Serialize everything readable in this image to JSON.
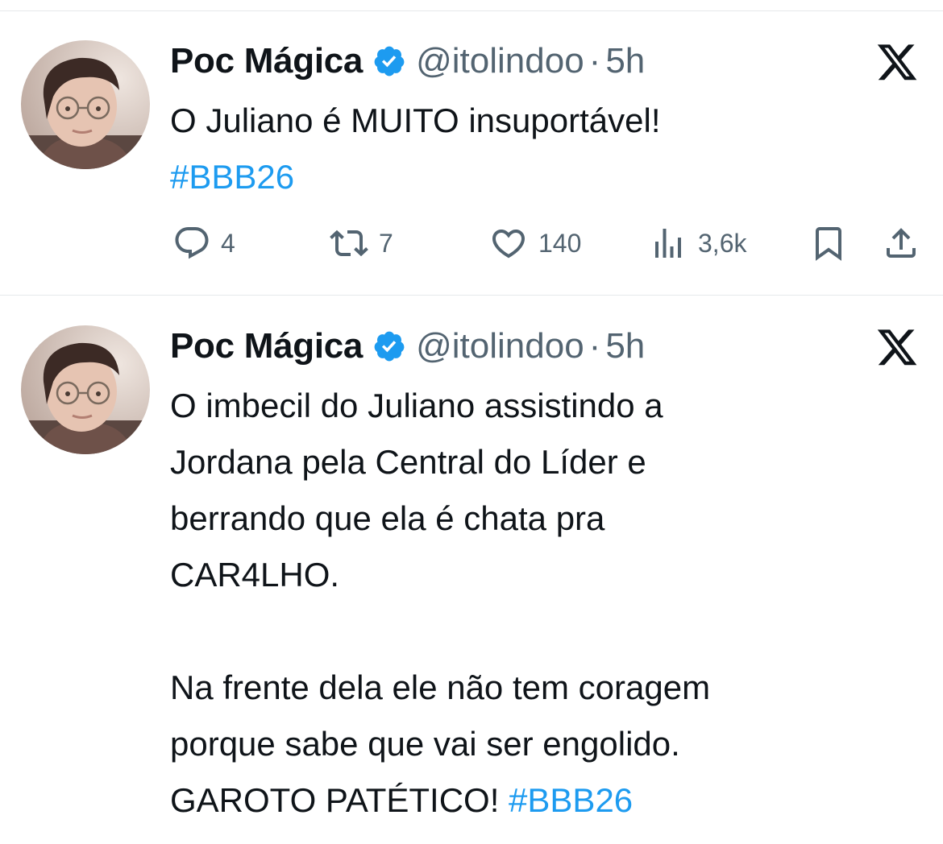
{
  "tweets": [
    {
      "author": {
        "name": "Poc Mágica",
        "handle": "@itolindoo",
        "separator": "·",
        "time": "5h"
      },
      "text": "O Juliano é MUITO insuportável!\n",
      "hashtag": "#BBB26",
      "stats": {
        "replies": "4",
        "retweets": "7",
        "likes": "140",
        "views": "3,6k"
      }
    },
    {
      "author": {
        "name": "Poc Mágica",
        "handle": "@itolindoo",
        "separator": "·",
        "time": "5h"
      },
      "text": "O imbecil do Juliano assistindo a\nJordana pela Central do Líder e\nberrando que ela é chata pra\nCAR4LHO.\n\nNa frente dela ele não tem coragem\nporque sabe que vai ser engolido.\nGAROTO PATÉTICO! ",
      "hashtag": "#BBB26"
    }
  ],
  "icons": {
    "verified": "verified-badge-icon",
    "platform": "x-logo-icon",
    "reply": "reply-icon",
    "retweet": "retweet-icon",
    "like": "heart-icon",
    "views": "views-icon",
    "bookmark": "bookmark-icon",
    "share": "share-icon"
  },
  "colors": {
    "text": "#0f1419",
    "secondary": "#536471",
    "accent": "#1d9bf0",
    "divider": "#e6e9eb"
  }
}
